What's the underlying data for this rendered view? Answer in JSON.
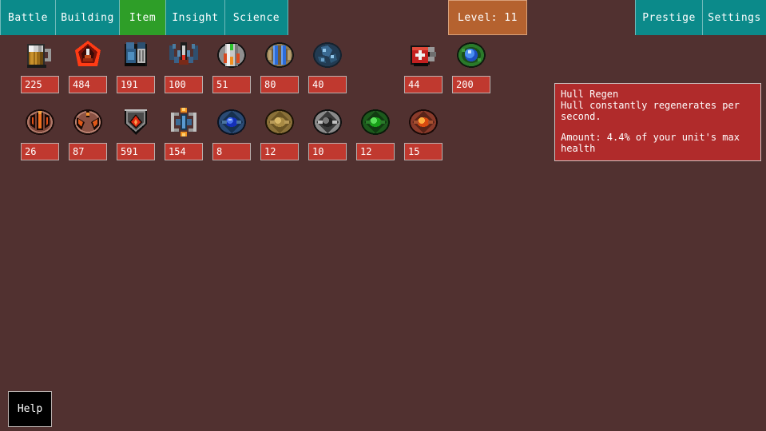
{
  "theme": {
    "background": "#513130",
    "nav_tab": "#0b8a8a",
    "nav_tab_active": "#2e9e28",
    "level_badge": "#b5622f",
    "value_box": "#c0392f",
    "tooltip_bg": "#b02b2b",
    "border_light": "#b9b0ae",
    "text": "#ffffff"
  },
  "nav": {
    "left_tabs": [
      {
        "label": "Battle",
        "active": false,
        "icon": "battle-tab"
      },
      {
        "label": "Building",
        "active": false,
        "icon": "building-tab"
      },
      {
        "label": "Item",
        "active": true,
        "icon": "item-tab"
      },
      {
        "label": "Insight",
        "active": false,
        "icon": "insight-tab"
      },
      {
        "label": "Science",
        "active": false,
        "icon": "science-tab"
      }
    ],
    "level_badge": "Level: 11",
    "right_tabs": [
      {
        "label": "Prestige",
        "active": false,
        "icon": "prestige-tab"
      },
      {
        "label": "Settings",
        "active": false,
        "icon": "settings-tab"
      }
    ]
  },
  "items": {
    "row1": [
      {
        "value": "225",
        "icon": "beer-mug-icon",
        "empty": false
      },
      {
        "value": "484",
        "icon": "red-diamond-emblem-icon",
        "empty": false
      },
      {
        "value": "191",
        "icon": "blue-machine-module-icon",
        "empty": false
      },
      {
        "value": "100",
        "icon": "winged-drone-icon",
        "empty": false
      },
      {
        "value": "51",
        "icon": "silver-capsule-icon",
        "empty": false
      },
      {
        "value": "80",
        "icon": "blue-twin-bar-icon",
        "empty": false
      },
      {
        "value": "40",
        "icon": "blue-crystal-rock-icon",
        "empty": false
      },
      {
        "value": "",
        "icon": "empty-slot",
        "empty": true
      },
      {
        "value": "44",
        "icon": "medkit-icon",
        "empty": false
      },
      {
        "value": "200",
        "icon": "green-blue-orb-icon",
        "empty": false
      }
    ],
    "row2": [
      {
        "value": "26",
        "icon": "red-claw-orb-icon",
        "empty": false
      },
      {
        "value": "87",
        "icon": "red-fang-orb-icon",
        "empty": false
      },
      {
        "value": "591",
        "icon": "red-star-shield-icon",
        "empty": false
      },
      {
        "value": "154",
        "icon": "engine-core-icon",
        "empty": false
      },
      {
        "value": "8",
        "icon": "blue-gem-disc-icon",
        "empty": false
      },
      {
        "value": "12",
        "icon": "bronze-gem-disc-icon",
        "empty": false
      },
      {
        "value": "10",
        "icon": "silver-gem-disc-icon",
        "empty": false
      },
      {
        "value": "12",
        "icon": "green-gem-disc-icon",
        "empty": false
      },
      {
        "value": "15",
        "icon": "red-gem-disc-icon",
        "empty": false
      }
    ]
  },
  "tooltip": {
    "title": "Hull Regen",
    "description": "Hull constantly regenerates per second.",
    "amount": "Amount: 4.4% of your unit's max health"
  },
  "help": {
    "label": "Help"
  }
}
